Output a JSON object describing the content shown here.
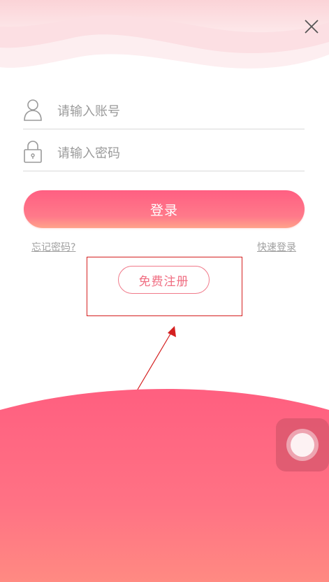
{
  "header": {
    "close_icon": "close-icon"
  },
  "form": {
    "account": {
      "icon": "user-icon",
      "placeholder": "请输入账号",
      "value": ""
    },
    "password": {
      "icon": "lock-icon",
      "placeholder": "请输入密码",
      "value": ""
    },
    "login_label": "登录",
    "forgot_label": "忘记密码?",
    "quick_login_label": "快速登录",
    "register_label": "免费注册"
  },
  "floating_ball": {
    "icon": "assistive-touch-icon"
  },
  "colors": {
    "primary": "#ff6382",
    "primary_light": "#ff8a8a",
    "annotation": "#d42020",
    "muted_text": "#a0a0a0"
  }
}
